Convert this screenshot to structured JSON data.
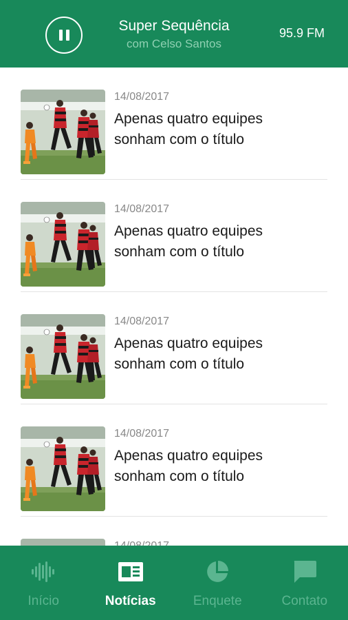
{
  "player": {
    "state_icon": "pause-icon",
    "title": "Super Sequência",
    "host": "com Celso Santos",
    "frequency": "95.9 FM"
  },
  "news": [
    {
      "date": "14/08/2017",
      "title": "Apenas quatro equipes sonham com o título",
      "image": "soccer-photo"
    },
    {
      "date": "14/08/2017",
      "title": "Apenas quatro equipes sonham com o título",
      "image": "soccer-photo"
    },
    {
      "date": "14/08/2017",
      "title": "Apenas quatro equipes sonham com o título",
      "image": "soccer-photo"
    },
    {
      "date": "14/08/2017",
      "title": "Apenas quatro equipes sonham com o título",
      "image": "soccer-photo"
    },
    {
      "date": "14/08/2017",
      "title": "",
      "image": "soccer-photo"
    }
  ],
  "nav": [
    {
      "label": "Início",
      "icon": "audio-wave-icon",
      "active": false
    },
    {
      "label": "Notícias",
      "icon": "newspaper-icon",
      "active": true
    },
    {
      "label": "Enquete",
      "icon": "pie-chart-icon",
      "active": false
    },
    {
      "label": "Contato",
      "icon": "chat-bubble-icon",
      "active": false
    }
  ],
  "colors": {
    "brand_green": "#18895a",
    "inactive_nav": "#5bb590",
    "active_nav": "#ffffff"
  }
}
